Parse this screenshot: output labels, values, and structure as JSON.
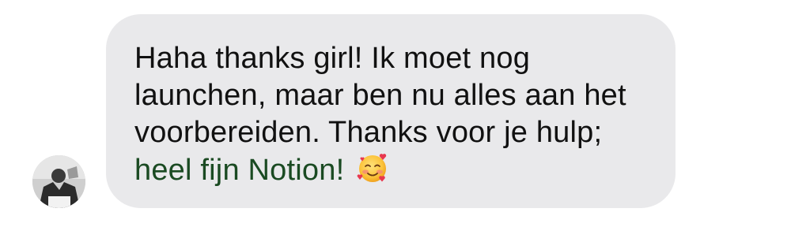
{
  "message": {
    "lines": [
      "Haha thanks girl! Ik moet nog",
      "launchen, maar ben nu alles aan het",
      "voorbereiden. Thanks voor je hulp;",
      "heel fijn Notion!"
    ],
    "emoji": "smiling-face-with-hearts-icon",
    "highlight_color": "#b0ec8c"
  },
  "bubble": {
    "background": "#e9e9eb"
  }
}
